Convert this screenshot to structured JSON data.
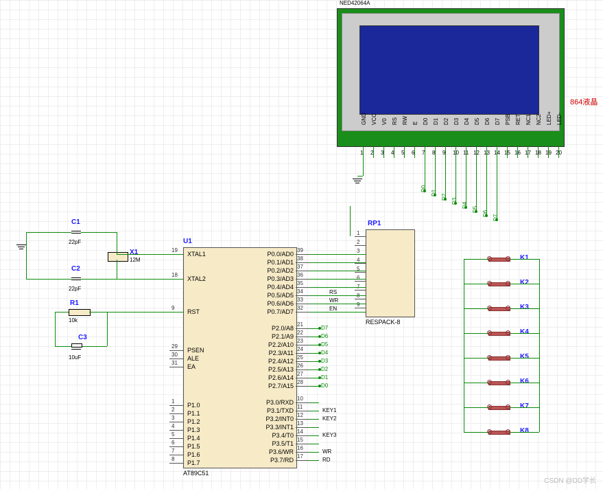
{
  "chart_data": {
    "type": "schematic",
    "components": [
      {
        "ref": "U1",
        "part": "AT89C51",
        "pins_left": [
          "XTAL1",
          "XTAL2",
          "RST",
          "PSEN",
          "ALE",
          "EA",
          "P1.0",
          "P1.1",
          "P1.2",
          "P1.3",
          "P1.4",
          "P1.5",
          "P1.6",
          "P1.7"
        ],
        "pins_right": [
          "P0.0/AD0",
          "P0.1/AD1",
          "P0.2/AD2",
          "P0.3/AD3",
          "P0.4/AD4",
          "P0.5/AD5",
          "P0.6/AD6",
          "P0.7/AD7",
          "P2.0/A8",
          "P2.1/A9",
          "P2.2/A10",
          "P2.3/A11",
          "P2.4/A12",
          "P2.5/A13",
          "P2.6/A14",
          "P2.7/A15",
          "P3.0/RXD",
          "P3.1/TXD",
          "P3.2/INT0",
          "P3.3/INT1",
          "P3.4/T0",
          "P3.5/T1",
          "P3.6/WR",
          "P3.7/RD"
        ]
      },
      {
        "ref": "C1",
        "part": "22pF"
      },
      {
        "ref": "C2",
        "part": "22pF"
      },
      {
        "ref": "C3",
        "part": "10uF"
      },
      {
        "ref": "R1",
        "part": "10k"
      },
      {
        "ref": "X1",
        "part": "12M"
      },
      {
        "ref": "RP1",
        "part": "RESPACK-8"
      },
      {
        "ref": "LCD",
        "part": "NED42064A"
      },
      {
        "ref": "K1"
      },
      {
        "ref": "K2"
      },
      {
        "ref": "K3"
      },
      {
        "ref": "K4"
      },
      {
        "ref": "K5"
      },
      {
        "ref": "K6"
      },
      {
        "ref": "K7"
      },
      {
        "ref": "K8"
      }
    ],
    "nets": [
      "RS",
      "WR",
      "EN",
      "RD",
      "KEY1",
      "KEY2",
      "KEY3",
      "D0",
      "D1",
      "D2",
      "D3",
      "D4",
      "D5",
      "D6",
      "D7"
    ],
    "lcd_pins": [
      "GND",
      "VCC",
      "V0",
      "RS",
      "RW",
      "E",
      "D0",
      "D1",
      "D2",
      "D3",
      "D4",
      "D5",
      "D6",
      "D7",
      "PSB",
      "RET",
      "NC1",
      "NC2",
      "LED+",
      "LED-"
    ]
  },
  "u1": {
    "ref": "U1",
    "part": "AT89C51",
    "left_nums": [
      "19",
      "18",
      "9",
      "29",
      "30",
      "31",
      "1",
      "2",
      "3",
      "4",
      "5",
      "6",
      "7",
      "8"
    ],
    "left_lbls": [
      "XTAL1",
      "XTAL2",
      "RST",
      "PSEN",
      "ALE",
      "EA",
      "P1.0",
      "P1.1",
      "P1.2",
      "P1.3",
      "P1.4",
      "P1.5",
      "P1.6",
      "P1.7"
    ],
    "right_lbls": [
      "P0.0/AD0",
      "P0.1/AD1",
      "P0.2/AD2",
      "P0.3/AD3",
      "P0.4/AD4",
      "P0.5/AD5",
      "P0.6/AD6",
      "P0.7/AD7",
      "P2.0/A8",
      "P2.1/A9",
      "P2.2/A10",
      "P2.3/A11",
      "P2.4/A12",
      "P2.5/A13",
      "P2.6/A14",
      "P2.7/A15",
      "P3.0/RXD",
      "P3.1/TXD",
      "P3.2/INT0",
      "P3.3/INT1",
      "P3.4/T0",
      "P3.5/T1",
      "P3.6/WR",
      "P3.7/RD"
    ],
    "right_nums": [
      "39",
      "38",
      "37",
      "36",
      "35",
      "34",
      "33",
      "32",
      "21",
      "22",
      "23",
      "24",
      "25",
      "26",
      "27",
      "28",
      "10",
      "11",
      "12",
      "13",
      "14",
      "15",
      "16",
      "17"
    ]
  },
  "rp1": {
    "ref": "RP1",
    "part": "RESPACK-8",
    "left_nums": [
      "1",
      "2",
      "3",
      "4",
      "5",
      "6",
      "7",
      "8",
      "9"
    ]
  },
  "lcd": {
    "part": "NED42064A",
    "pins": [
      "GND",
      "VCC",
      "V0",
      "RS",
      "RW",
      "E",
      "D0",
      "D1",
      "D2",
      "D3",
      "D4",
      "D5",
      "D6",
      "D7",
      "PSB",
      "RET",
      "NC1",
      "NC2",
      "LED+",
      "LED-"
    ],
    "pin_nums": [
      "1",
      "2",
      "3",
      "4",
      "5",
      "6",
      "7",
      "8",
      "9",
      "10",
      "11",
      "12",
      "13",
      "14",
      "15",
      "16",
      "17",
      "18",
      "19",
      "20"
    ]
  },
  "lcd_label": "864液晶",
  "c1": {
    "ref": "C1",
    "val": "22pF"
  },
  "c2": {
    "ref": "C2",
    "val": "22pF"
  },
  "c3": {
    "ref": "C3",
    "val": "10uF"
  },
  "r1": {
    "ref": "R1",
    "val": "10k"
  },
  "x1": {
    "ref": "X1",
    "val": "12M"
  },
  "buttons": [
    "K1",
    "K2",
    "K3",
    "K4",
    "K5",
    "K6",
    "K7",
    "K8"
  ],
  "nets": {
    "rs": "RS",
    "wr": "WR",
    "en": "EN",
    "rd": "RD",
    "key1": "KEY1",
    "key2": "KEY2",
    "key3": "KEY3",
    "d0": "D0",
    "d1": "D1",
    "d2": "D2",
    "d3": "D3",
    "d4": "D4",
    "d5": "D5",
    "d6": "D6",
    "d7": "D7"
  },
  "lcd_nets": [
    "D0",
    "D1",
    "D2",
    "D3",
    "D4",
    "D5",
    "D6",
    "D7"
  ],
  "watermark": "CSDN @DD学长"
}
